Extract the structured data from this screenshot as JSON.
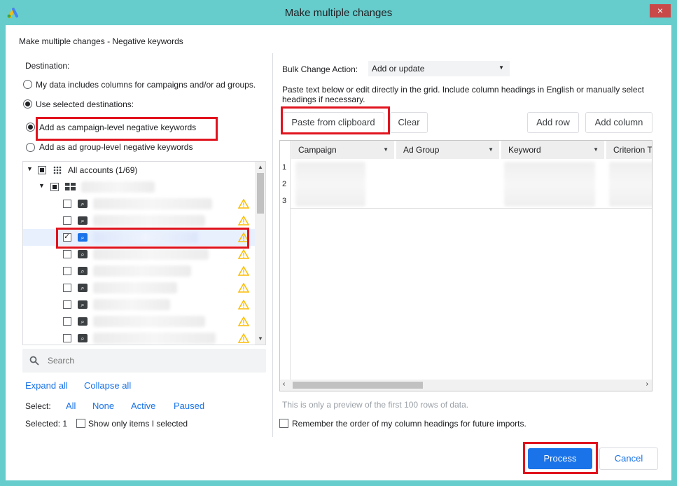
{
  "window": {
    "title": "Make multiple changes",
    "close_glyph": "×"
  },
  "dialog": {
    "subtitle": "Make multiple changes - Negative keywords"
  },
  "destination": {
    "label": "Destination:",
    "option_data_columns": "My data includes columns for campaigns and/or ad groups.",
    "option_selected": "Use selected destinations:",
    "option_campaign_level": "Add as campaign-level negative keywords",
    "option_adgroup_level": "Add as ad group-level negative keywords"
  },
  "tree": {
    "root_label": "All accounts (1/69)"
  },
  "search": {
    "placeholder": "Search"
  },
  "tree_actions": {
    "expand_all": "Expand all",
    "collapse_all": "Collapse all"
  },
  "select": {
    "label": "Select:",
    "all": "All",
    "none": "None",
    "active": "Active",
    "paused": "Paused"
  },
  "selected": {
    "count_label": "Selected: 1",
    "show_only": "Show only items I selected"
  },
  "bulk": {
    "label": "Bulk Change Action:",
    "value": "Add or update",
    "instructions": "Paste text below or edit directly in the grid. Include column headings in English or manually select headings if necessary."
  },
  "buttons": {
    "paste": "Paste from clipboard",
    "clear": "Clear",
    "add_row": "Add row",
    "add_column": "Add column",
    "process": "Process",
    "cancel": "Cancel"
  },
  "grid": {
    "columns": [
      "Campaign",
      "Ad Group",
      "Keyword",
      "Criterion T"
    ],
    "rows": [
      "1",
      "2",
      "3"
    ]
  },
  "preview_note": "This is only a preview of the first 100 rows of data.",
  "remember_label": "Remember the order of my column headings for future imports.",
  "colors": {
    "accent": "#1a73e8",
    "highlight": "#e0141e",
    "frame": "#66cccc",
    "warning": "#fbbc04"
  }
}
